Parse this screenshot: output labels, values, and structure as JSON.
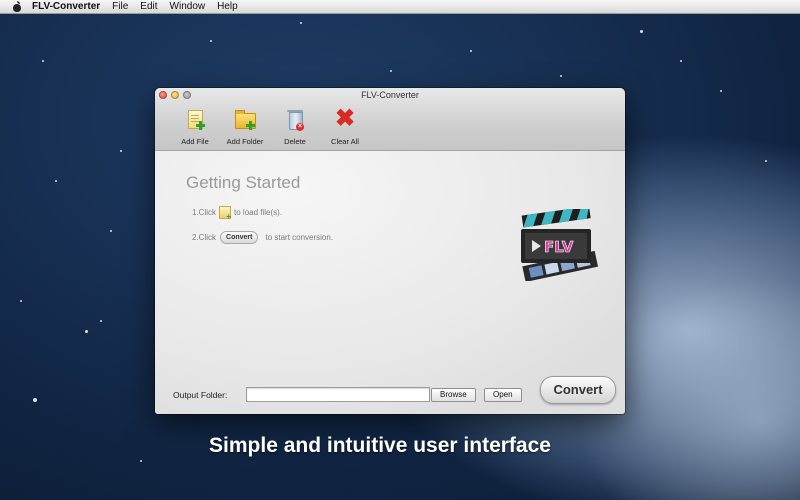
{
  "menubar": {
    "app_name": "FLV-Converter",
    "items": [
      "File",
      "Edit",
      "Window",
      "Help"
    ]
  },
  "window": {
    "title": "FLV-Converter",
    "toolbar": [
      {
        "label": "Add File",
        "icon": "add-file-icon"
      },
      {
        "label": "Add Folder",
        "icon": "add-folder-icon"
      },
      {
        "label": "Delete",
        "icon": "trash-icon"
      },
      {
        "label": "Clear All",
        "icon": "red-x-icon"
      }
    ],
    "getting_started": {
      "heading": "Getting Started",
      "step1_prefix": "1.Click",
      "step1_suffix": "to load file(s).",
      "step2_prefix": "2.Click",
      "step2_button": "Convert",
      "step2_suffix": "to start conversion."
    },
    "logo_text": "FLV",
    "output": {
      "label": "Output Folder:",
      "value": "",
      "browse_label": "Browse",
      "open_label": "Open",
      "convert_label": "Convert"
    }
  },
  "caption": "Simple and intuitive user interface",
  "colors": {
    "accent_red": "#d82b22",
    "flv_pink": "#d63aa0",
    "clapper_teal": "#3fb6c4"
  }
}
